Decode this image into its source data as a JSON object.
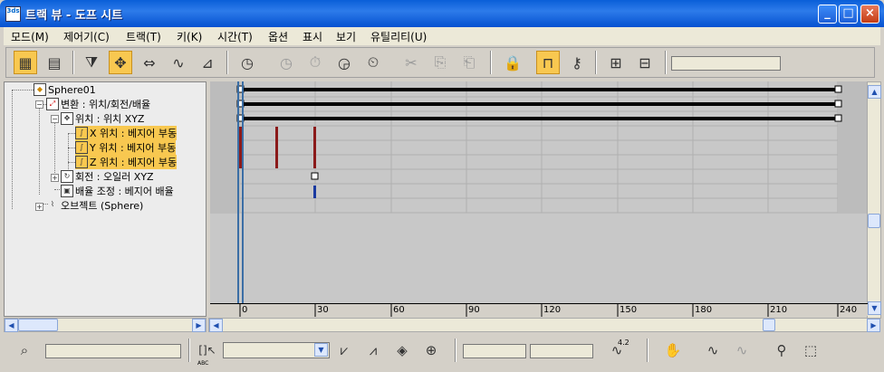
{
  "window": {
    "title": "트랙 뷰 - 도프 시트",
    "app_icon_text": "3ds",
    "min": "_",
    "max": "□",
    "close": "×"
  },
  "menu": [
    "모드(M)",
    "제어기(C)",
    "트랙(T)",
    "키(K)",
    "시간(T)",
    "옵션",
    "표시",
    "보기",
    "유틸리티(U)"
  ],
  "tree": {
    "items": [
      {
        "label": "Sphere01",
        "icon": "sphere-icon"
      },
      {
        "label": "변환 : 위치/회전/배율",
        "icon": "transform-icon"
      },
      {
        "label": "위치 : 위치 XYZ",
        "icon": "position-icon"
      },
      {
        "label": "X 위치 : 베지어 부동",
        "icon": "curve-icon",
        "highlight": true
      },
      {
        "label": "Y 위치 : 베지어 부동",
        "icon": "curve-icon",
        "highlight": true
      },
      {
        "label": "Z 위치 : 베지어 부동",
        "icon": "curve-icon",
        "highlight": true
      },
      {
        "label": "회전 : 오일러 XYZ",
        "icon": "rotation-icon"
      },
      {
        "label": "배율 조정 : 베지어 배율",
        "icon": "scale-icon"
      },
      {
        "label": "오브젝트 (Sphere)",
        "icon": "object-icon"
      }
    ]
  },
  "ruler": {
    "ticks": [
      "0",
      "30",
      "60",
      "90",
      "120",
      "150",
      "180",
      "210",
      "240"
    ]
  },
  "bottom": {
    "abc_label": "ABC",
    "curve_value": "4.2"
  },
  "colors": {
    "highlight": "#f8c850",
    "key_red": "#8b1a1a",
    "key_blue": "#1a3aa0",
    "time_slider": "#3b6ea5",
    "title": "#0a5fd8"
  }
}
